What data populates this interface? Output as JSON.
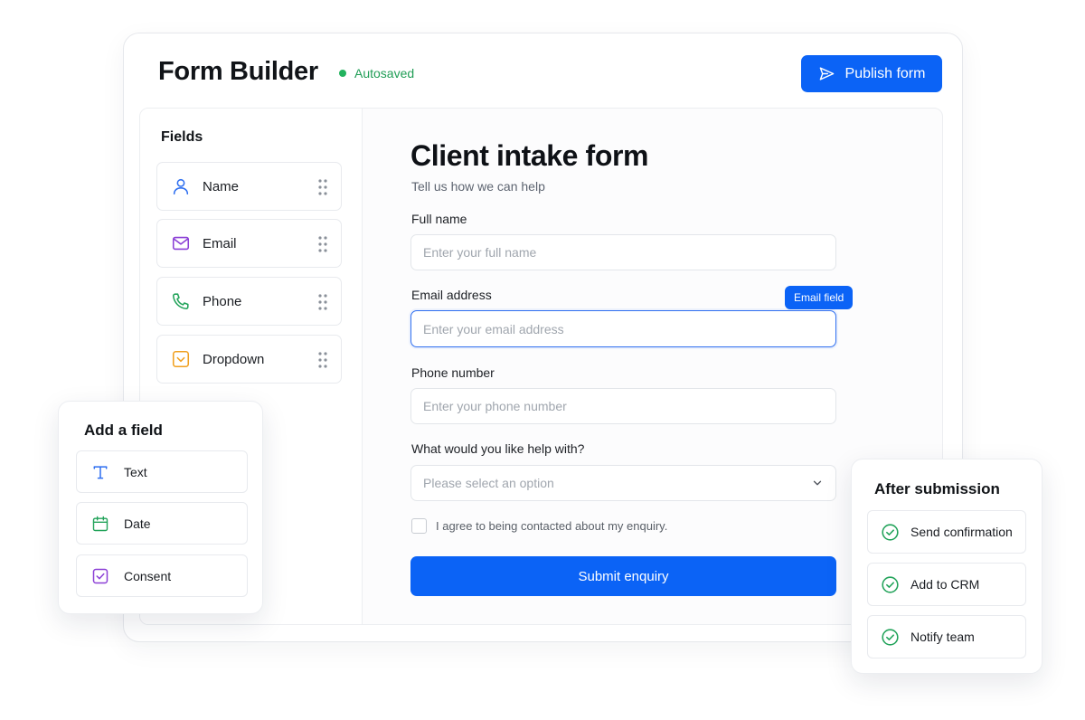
{
  "header": {
    "title": "Form Builder",
    "status": "Autosaved",
    "publish_label": "Publish form"
  },
  "sidebar": {
    "title": "Fields",
    "items": [
      {
        "label": "Name",
        "icon": "user-icon"
      },
      {
        "label": "Email",
        "icon": "mail-icon"
      },
      {
        "label": "Phone",
        "icon": "phone-icon"
      },
      {
        "label": "Dropdown",
        "icon": "dropdown-icon"
      }
    ]
  },
  "form": {
    "title": "Client intake form",
    "subtitle": "Tell us how we can help",
    "fields": {
      "full_name": {
        "label": "Full name",
        "placeholder": "Enter your full name"
      },
      "email": {
        "label": "Email address",
        "placeholder": "Enter your email address",
        "tag": "Email field"
      },
      "phone": {
        "label": "Phone number",
        "placeholder": "Enter your phone number"
      },
      "help": {
        "label": "What would you like help with?",
        "placeholder": "Please select an option"
      }
    },
    "consent_text": "I agree to being contacted about my enquiry.",
    "submit_label": "Submit enquiry"
  },
  "add_field": {
    "title": "Add a field",
    "items": [
      {
        "label": "Text",
        "icon": "text-icon"
      },
      {
        "label": "Date",
        "icon": "calendar-icon"
      },
      {
        "label": "Consent",
        "icon": "checkbox-icon"
      }
    ]
  },
  "after_submission": {
    "title": "After submission",
    "items": [
      {
        "label": "Send confirmation",
        "icon": "check-circle-icon"
      },
      {
        "label": "Add to CRM",
        "icon": "check-circle-icon"
      },
      {
        "label": "Notify team",
        "icon": "check-circle-icon"
      }
    ]
  },
  "colors": {
    "accent": "#0b63f6",
    "success": "#22b35e",
    "mail_icon": "#8b3fd6",
    "phone_icon": "#22a35a",
    "dropdown_icon": "#f0a020",
    "user_icon": "#2f6ff0"
  }
}
